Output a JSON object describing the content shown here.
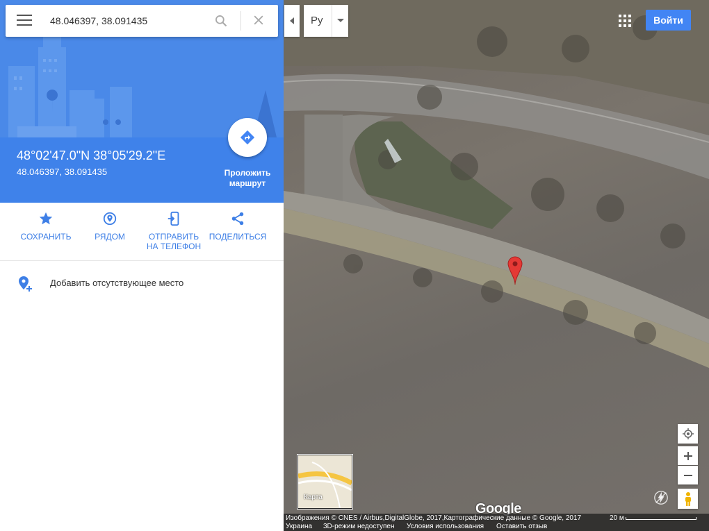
{
  "search": {
    "value": "48.046397, 38.091435",
    "menu_icon": "hamburger-menu-icon",
    "search_icon": "search-icon",
    "close_icon": "close-icon"
  },
  "place": {
    "dms": "48°02'47.0\"N 38°05'29.2\"E",
    "decimal": "48.046397, 38.091435",
    "route_label": "Проложить маршрут"
  },
  "actions": [
    {
      "label": "СОХРАНИТЬ",
      "icon": "star-icon"
    },
    {
      "label": "РЯДОМ",
      "icon": "nearby-pin-icon"
    },
    {
      "label": "ОТПРАВИТЬ НА ТЕЛЕФОН",
      "icon": "send-to-phone-icon"
    },
    {
      "label": "ПОДЕЛИТЬСЯ",
      "icon": "share-icon"
    }
  ],
  "add_place": {
    "label": "Добавить отсутствующее место",
    "icon": "add-place-icon"
  },
  "top_bar": {
    "language": "Ру",
    "signin": "Войти"
  },
  "minimap": {
    "label": "Карта"
  },
  "map": {
    "logo": "Google",
    "scale": "20 м"
  },
  "footer": {
    "attribution": "Изображения © CNES / Airbus,DigitalGlobe, 2017,Картографические данные © Google, 2017",
    "links": [
      "Украина",
      "3D-режим недоступен",
      "Условия использования",
      "Оставить отзыв"
    ]
  },
  "colors": {
    "accent": "#4285f4",
    "hero": "#4a89e8",
    "marker": "#e53935"
  }
}
